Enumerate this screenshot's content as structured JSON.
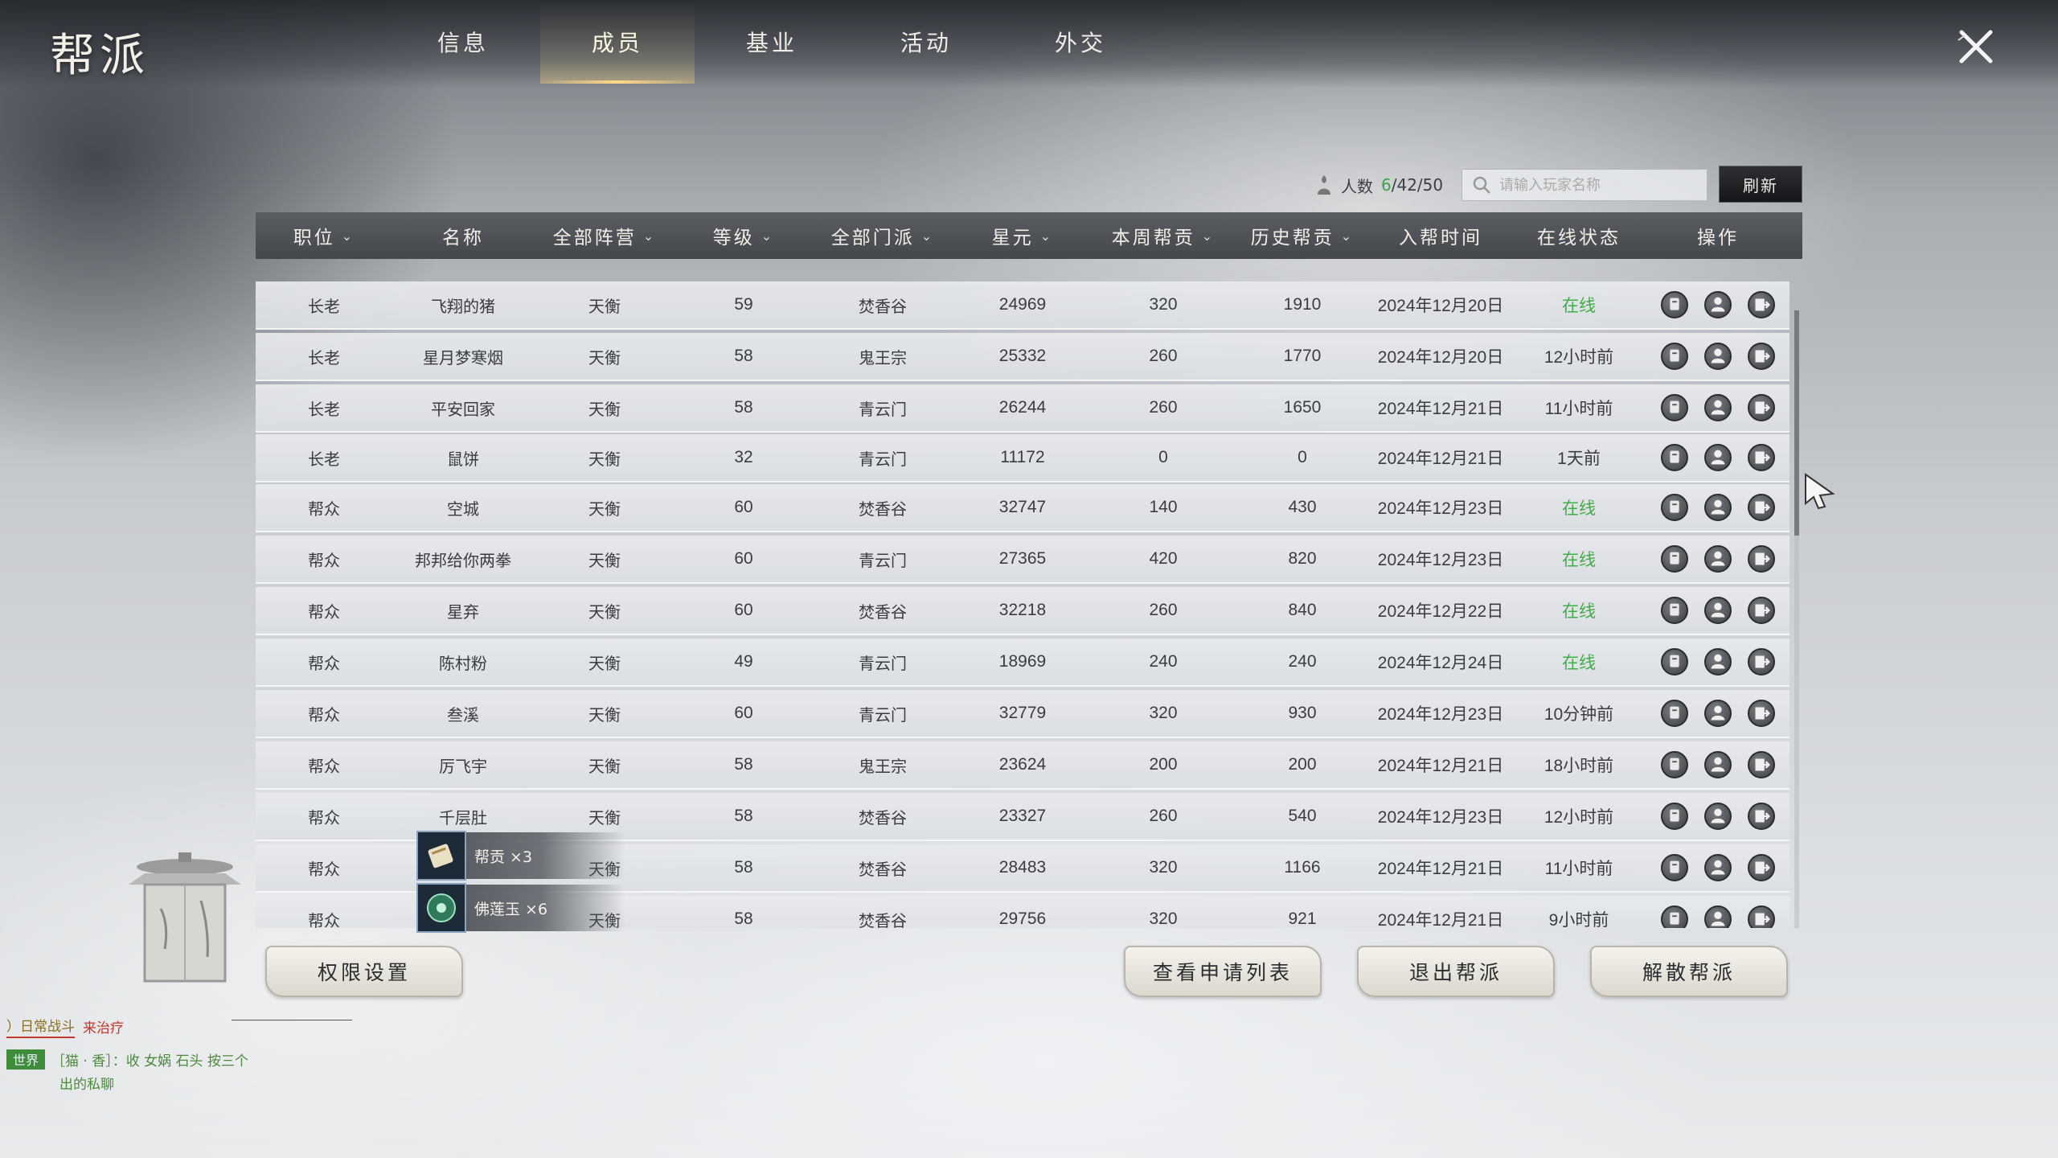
{
  "window": {
    "title": "帮派"
  },
  "tabs": [
    {
      "label": "信息",
      "active": false
    },
    {
      "label": "成员",
      "active": true
    },
    {
      "label": "基业",
      "active": false
    },
    {
      "label": "活动",
      "active": false
    },
    {
      "label": "外交",
      "active": false
    }
  ],
  "member_count": {
    "label": "人数",
    "online": "6",
    "rest": "/42/50"
  },
  "search": {
    "placeholder": "请输入玩家名称"
  },
  "refresh_label": "刷新",
  "columns": [
    {
      "label": "职位",
      "sortable": true
    },
    {
      "label": "名称",
      "sortable": false
    },
    {
      "label": "全部阵营",
      "sortable": true
    },
    {
      "label": "等级",
      "sortable": true
    },
    {
      "label": "全部门派",
      "sortable": true
    },
    {
      "label": "星元",
      "sortable": true
    },
    {
      "label": "本周帮贡",
      "sortable": true
    },
    {
      "label": "历史帮贡",
      "sortable": true
    },
    {
      "label": "入帮时间",
      "sortable": false
    },
    {
      "label": "在线状态",
      "sortable": false
    },
    {
      "label": "操作",
      "sortable": false
    }
  ],
  "rows": [
    {
      "rank": "长老",
      "name": "飞翔的猪",
      "camp": "天衡",
      "level": "59",
      "sect": "焚香谷",
      "xingyuan": "24969",
      "week": "320",
      "history": "1910",
      "joined": "2024年12月20日",
      "status": "在线",
      "online": true
    },
    {
      "rank": "长老",
      "name": "星月梦寒烟",
      "camp": "天衡",
      "level": "58",
      "sect": "鬼王宗",
      "xingyuan": "25332",
      "week": "260",
      "history": "1770",
      "joined": "2024年12月20日",
      "status": "12小时前",
      "online": false
    },
    {
      "rank": "长老",
      "name": "平安回家",
      "camp": "天衡",
      "level": "58",
      "sect": "青云门",
      "xingyuan": "26244",
      "week": "260",
      "history": "1650",
      "joined": "2024年12月21日",
      "status": "11小时前",
      "online": false
    },
    {
      "rank": "长老",
      "name": "鼠饼",
      "camp": "天衡",
      "level": "32",
      "sect": "青云门",
      "xingyuan": "11172",
      "week": "0",
      "history": "0",
      "joined": "2024年12月21日",
      "status": "1天前",
      "online": false
    },
    {
      "rank": "帮众",
      "name": "空城",
      "camp": "天衡",
      "level": "60",
      "sect": "焚香谷",
      "xingyuan": "32747",
      "week": "140",
      "history": "430",
      "joined": "2024年12月23日",
      "status": "在线",
      "online": true
    },
    {
      "rank": "帮众",
      "name": "邦邦给你两拳",
      "camp": "天衡",
      "level": "60",
      "sect": "青云门",
      "xingyuan": "27365",
      "week": "420",
      "history": "820",
      "joined": "2024年12月23日",
      "status": "在线",
      "online": true
    },
    {
      "rank": "帮众",
      "name": "星弃",
      "camp": "天衡",
      "level": "60",
      "sect": "焚香谷",
      "xingyuan": "32218",
      "week": "260",
      "history": "840",
      "joined": "2024年12月22日",
      "status": "在线",
      "online": true
    },
    {
      "rank": "帮众",
      "name": "陈村粉",
      "camp": "天衡",
      "level": "49",
      "sect": "青云门",
      "xingyuan": "18969",
      "week": "240",
      "history": "240",
      "joined": "2024年12月24日",
      "status": "在线",
      "online": true
    },
    {
      "rank": "帮众",
      "name": "叁溪",
      "camp": "天衡",
      "level": "60",
      "sect": "青云门",
      "xingyuan": "32779",
      "week": "320",
      "history": "930",
      "joined": "2024年12月23日",
      "status": "10分钟前",
      "online": false
    },
    {
      "rank": "帮众",
      "name": "厉飞宇",
      "camp": "天衡",
      "level": "58",
      "sect": "鬼王宗",
      "xingyuan": "23624",
      "week": "200",
      "history": "200",
      "joined": "2024年12月21日",
      "status": "18小时前",
      "online": false
    },
    {
      "rank": "帮众",
      "name": "千层肚",
      "camp": "天衡",
      "level": "58",
      "sect": "焚香谷",
      "xingyuan": "23327",
      "week": "260",
      "history": "540",
      "joined": "2024年12月23日",
      "status": "12小时前",
      "online": false
    },
    {
      "rank": "帮众",
      "name": "",
      "camp": "天衡",
      "level": "58",
      "sect": "焚香谷",
      "xingyuan": "28483",
      "week": "320",
      "history": "1166",
      "joined": "2024年12月21日",
      "status": "11小时前",
      "online": false
    },
    {
      "rank": "帮众",
      "name": "",
      "camp": "天衡",
      "level": "58",
      "sect": "焚香谷",
      "xingyuan": "29756",
      "week": "320",
      "history": "921",
      "joined": "2024年12月21日",
      "status": "9小时前",
      "online": false
    }
  ],
  "rewards": [
    {
      "label": "帮贡 ×3",
      "icon": "scroll-icon"
    },
    {
      "label": "佛莲玉 ×6",
      "icon": "jade-icon"
    }
  ],
  "buttons": {
    "permissions": "权限设置",
    "applications": "查看申请列表",
    "leave": "退出帮派",
    "disband": "解散帮派"
  },
  "chat": {
    "line1_label": "）日常战斗",
    "line1_text": "来治疗",
    "tag": "世界",
    "line2": "［猫 · 香］：收 女娲 石头 按三个",
    "line3": "出的私聊"
  },
  "colors": {
    "online": "#3fae46",
    "header_bg": "#4f5257",
    "accent_gold": "#ffd98a"
  }
}
